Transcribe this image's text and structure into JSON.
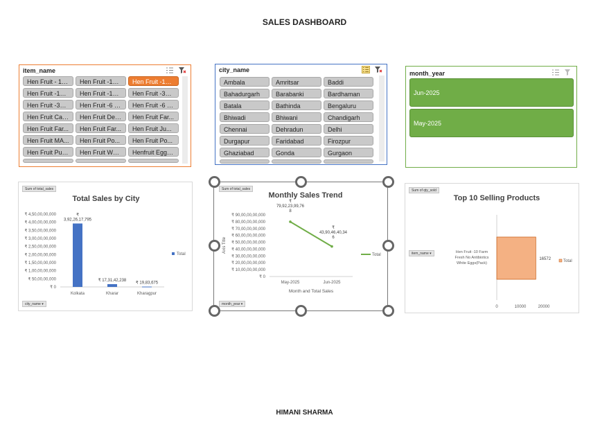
{
  "dashboard": {
    "title": "SALES DASHBOARD",
    "footer": "HIMANI SHARMA"
  },
  "colors": {
    "item_border": "#ed7d31",
    "city_border": "#4472c4",
    "month_border": "#70ad47",
    "bar_blue": "#4472c4",
    "line_green": "#70ad47",
    "bar_orange": "#f4b183"
  },
  "slicers": {
    "item": {
      "header": "item_name",
      "icons": [
        "multi-select-icon",
        "clear-filter-icon"
      ],
      "items": [
        "Hen Fruit - 10 ...",
        "Hen Fruit -10 ...",
        "Hen Fruit -10 ...",
        "Hen Fruit -10 ...",
        "Hen Fruit -10 ...",
        "Hen Fruit -30 ...",
        "Hen Fruit -30 ...",
        "Hen Fruit -6 F...",
        "Hen Fruit -6 H...",
        "Hen Fruit Cag...",
        "Hen Fruit Des...",
        "Hen Fruit Far...",
        "Hen Fruit Far...",
        "Hen Fruit Far...",
        "Hen Fruit Ju...",
        "Hen Fruit MA...",
        "Hen Fruit Po...",
        "Hen Fruit Po...",
        "Hen Fruit Pull...",
        "Hen Fruit Whi...",
        "Henfruit Eggs..."
      ],
      "selected_index": 2
    },
    "city": {
      "header": "city_name",
      "icons": [
        "multi-select-icon",
        "clear-filter-icon"
      ],
      "items": [
        "Ambala",
        "Amritsar",
        "Baddi",
        "Bahadurgarh",
        "Barabanki",
        "Bardhaman",
        "Batala",
        "Bathinda",
        "Bengaluru",
        "Bhiwadi",
        "Bhiwani",
        "Chandigarh",
        "Chennai",
        "Dehradun",
        "Delhi",
        "Durgapur",
        "Faridabad",
        "Firozpur",
        "Ghaziabad",
        "Gonda",
        "Gurgaon"
      ]
    },
    "month": {
      "header": "month_year",
      "icons": [
        "multi-select-icon",
        "clear-filter-icon"
      ],
      "items": [
        "Jun-2025",
        "May-2025"
      ]
    }
  },
  "charts": {
    "city": {
      "field_top": "Sum of total_sales",
      "field_bottom": "city_name",
      "title": "Total Sales by City",
      "legend": "Total",
      "y_ticks": [
        "₹ 4,50,00,00,000",
        "₹ 4,00,00,00,000",
        "₹ 3,50,00,00,000",
        "₹ 3,00,00,00,000",
        "₹ 2,50,00,00,000",
        "₹ 2,00,00,00,000",
        "₹ 1,50,00,00,000",
        "₹ 1,00,00,00,000",
        "₹ 50,00,00,000",
        "₹ 0"
      ]
    },
    "trend": {
      "field_top": "Sum of total_sales",
      "field_bottom": "month_year",
      "title": "Monthly Sales Trend",
      "ylabel": "Axis Title",
      "xlabel": "Month and Total Sales",
      "legend": "Total",
      "y_ticks": [
        "₹ 90,00,00,00,000",
        "₹ 80,00,00,00,000",
        "₹ 70,00,00,00,000",
        "₹ 60,00,00,00,000",
        "₹ 50,00,00,00,000",
        "₹ 40,00,00,00,000",
        "₹ 30,00,00,00,000",
        "₹ 20,00,00,00,000",
        "₹ 10,00,00,00,000",
        "₹ 0"
      ]
    },
    "products": {
      "field_top": "Sum of qty_sold",
      "field_left": "item_name",
      "title": "Top 10 Selling Products",
      "legend": "Total",
      "x_ticks": [
        "0",
        "10000",
        "20000"
      ]
    }
  },
  "chart_data": [
    {
      "type": "bar",
      "title": "Total Sales by City",
      "categories": [
        "Kolkata",
        "Kharar",
        "Kharagpur"
      ],
      "values": [
        3922617795,
        173142238,
        19834675
      ],
      "data_labels": [
        "₹\n3,92,26,17,795",
        "₹ 17,31,42,238",
        "₹ 19,83,675"
      ],
      "series": [
        {
          "name": "Total",
          "values": [
            3922617795,
            173142238,
            19834675
          ]
        }
      ],
      "ylim": [
        0,
        4500000000
      ],
      "grid": false,
      "legend": "right"
    },
    {
      "type": "line",
      "title": "Monthly Sales Trend",
      "categories": [
        "May-2025",
        "Jun-2025"
      ],
      "values": [
        79922399768,
        43904640346
      ],
      "data_labels": [
        "₹\n79,92,23,99,76\n8",
        "₹\n43,90,46,40,34\n6"
      ],
      "series": [
        {
          "name": "Total",
          "values": [
            79922399768,
            43904640346
          ]
        }
      ],
      "ylim": [
        0,
        90000000000
      ],
      "xlabel": "Month and Total Sales",
      "ylabel": "Axis Title",
      "legend": "right"
    },
    {
      "type": "bar",
      "orientation": "horizontal",
      "title": "Top 10 Selling Products",
      "categories": [
        "Hen Fruit -10 Farm Fresh No Antibiotics White Eggs(Pack)"
      ],
      "values": [
        16572
      ],
      "data_labels": [
        "16572"
      ],
      "series": [
        {
          "name": "Total",
          "values": [
            16572
          ]
        }
      ],
      "xlim": [
        0,
        20000
      ],
      "legend": "right"
    }
  ]
}
